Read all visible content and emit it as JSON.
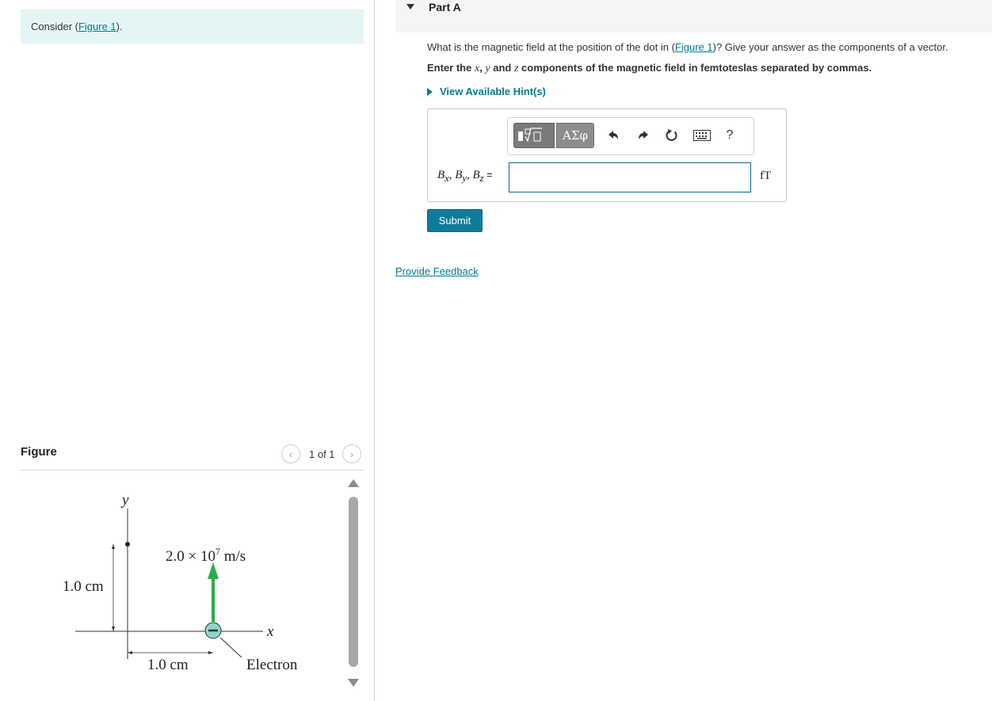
{
  "left_panel": {
    "consider_prefix": "Consider (",
    "figure_link": "Figure 1",
    "consider_suffix": ")."
  },
  "figure_panel": {
    "title": "Figure",
    "pager": "1 of 1",
    "prev_icon": "chevron-left-icon",
    "next_icon": "chevron-right-icon",
    "diagram": {
      "y_axis_label": "y",
      "x_axis_label": "x",
      "velocity_label": "2.0 × 10",
      "velocity_exponent": "7",
      "velocity_unit": " m/s",
      "vertical_distance": "1.0 cm",
      "horizontal_distance": "1.0 cm",
      "particle_label": "Electron",
      "particle_symbol": "minus-sign",
      "arrow_color": "#2eaa4a",
      "particle_fill": "#8fd3cc"
    }
  },
  "part": {
    "title": "Part A",
    "question_prefix": "What is the magnetic field at the position of the dot in (",
    "question_link": "Figure 1",
    "question_suffix": ")? Give your answer as the components of a vector.",
    "instruction_prefix": "Enter the ",
    "instruction_x": "x",
    "instruction_comma": ", ",
    "instruction_y": "y",
    "instruction_and": " and ",
    "instruction_z": "z",
    "instruction_suffix": " components of the magnetic field in femtoteslas separated by commas.",
    "hint_label": "View Available Hint(s)"
  },
  "answer": {
    "label_bx": "B",
    "sub_x": "x",
    "label_by": "B",
    "sub_y": "y",
    "label_bz": "B",
    "sub_z": "z",
    "separator": ", ",
    "equals": " =",
    "input_value": "",
    "unit": "fT",
    "toolbar": {
      "greek_label": "ΑΣφ",
      "help_label": "?",
      "templates_icon": "templates-icon",
      "undo_icon": "undo-icon",
      "redo_icon": "redo-icon",
      "reset_icon": "reset-icon",
      "keyboard_icon": "keyboard-icon"
    }
  },
  "submit_label": "Submit",
  "feedback_label": "Provide Feedback",
  "colors": {
    "accent": "#007c91",
    "submit_bg": "#0e7c99",
    "banner_bg": "#e5f5f6"
  }
}
